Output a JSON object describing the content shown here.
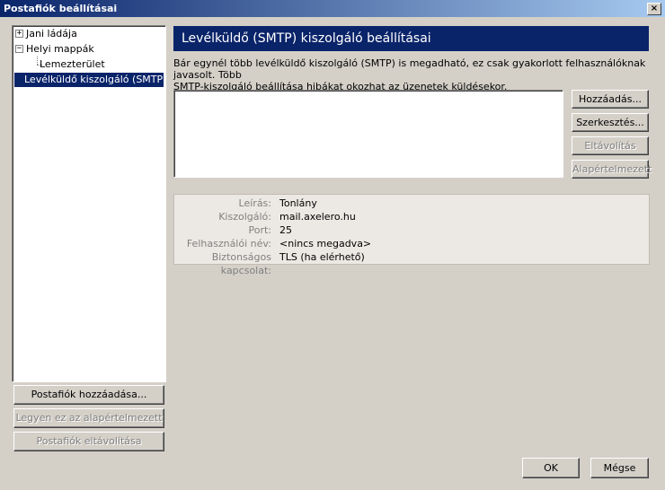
{
  "window": {
    "title": "Postafiók beállításai",
    "close_glyph": "×"
  },
  "tree": {
    "items": [
      {
        "label": "Jani ládája",
        "expander": "+"
      },
      {
        "label": "Helyi mappák",
        "expander": "−"
      },
      {
        "label": "Lemezterület"
      },
      {
        "label": "Levélküldő kiszolgáló (SMTP)",
        "selected": true
      }
    ]
  },
  "left_buttons": {
    "add_account": "Postafiók hozzáadása...",
    "set_default": "Legyen ez az alapértelmezett",
    "remove_account": "Postafiók eltávolítása"
  },
  "panel": {
    "header": "Levélküldő (SMTP) kiszolgáló beállításai",
    "description_line1": "Bár egynél több levélküldő kiszolgáló (SMTP) is megadható, ez csak gyakorlott felhasználóknak javasolt. Több",
    "description_line2": "SMTP-kiszolgáló beállítása hibákat okozhat az üzenetek küldésekor."
  },
  "smtp_buttons": {
    "add": "Hozzáadás...",
    "edit": "Szerkesztés...",
    "remove": "Eltávolítás",
    "set_default": "Alapértelmezett"
  },
  "details": {
    "description_label": "Leírás:",
    "description_value": "Tonlány",
    "server_label": "Kiszolgáló:",
    "server_value": "mail.axelero.hu",
    "port_label": "Port:",
    "port_value": "25",
    "username_label": "Felhasználói név:",
    "username_value": "<nincs megadva>",
    "secure_label": "Biztonságos kapcsolat:",
    "secure_value": "TLS (ha elérhető)"
  },
  "dialog_buttons": {
    "ok": "OK",
    "cancel": "Mégse"
  }
}
